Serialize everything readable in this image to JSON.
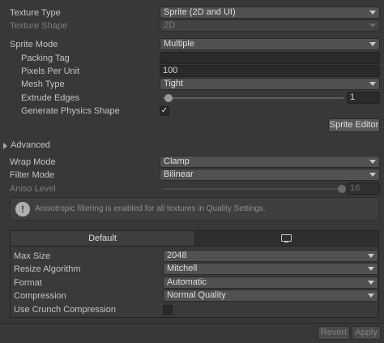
{
  "texture_type": {
    "label": "Texture Type",
    "value": "Sprite (2D and UI)"
  },
  "texture_shape": {
    "label": "Texture Shape",
    "value": "2D"
  },
  "sprite_mode": {
    "label": "Sprite Mode",
    "value": "Multiple"
  },
  "packing_tag": {
    "label": "Packing Tag",
    "value": ""
  },
  "pixels_per_unit": {
    "label": "Pixels Per Unit",
    "value": "100"
  },
  "mesh_type": {
    "label": "Mesh Type",
    "value": "Tight"
  },
  "extrude_edges": {
    "label": "Extrude Edges",
    "value": "1",
    "level": 0
  },
  "generate_physics_shape": {
    "label": "Generate Physics Shape",
    "checked": true,
    "mark": "✓"
  },
  "sprite_editor_button": "Sprite Editor",
  "advanced": {
    "label": "Advanced",
    "expanded": false
  },
  "wrap_mode": {
    "label": "Wrap Mode",
    "value": "Clamp"
  },
  "filter_mode": {
    "label": "Filter Mode",
    "value": "Bilinear"
  },
  "aniso_level": {
    "label": "Aniso Level",
    "value": "16",
    "max": 16
  },
  "info": {
    "icon": "info-icon",
    "glyph": "!",
    "text": "Anisotropic filtering is enabled for all textures in Quality Settings."
  },
  "platform_tabs": [
    {
      "label": "Default",
      "active": true
    },
    {
      "icon": "monitor-icon",
      "active": false
    }
  ],
  "max_size": {
    "label": "Max Size",
    "value": "2048"
  },
  "resize_algorithm": {
    "label": "Resize Algorithm",
    "value": "Mitchell"
  },
  "format": {
    "label": "Format",
    "value": "Automatic"
  },
  "compression": {
    "label": "Compression",
    "value": "Normal Quality"
  },
  "use_crunch_compression": {
    "label": "Use Crunch Compression",
    "checked": false
  },
  "footer": {
    "revert": "Revert",
    "apply": "Apply"
  }
}
